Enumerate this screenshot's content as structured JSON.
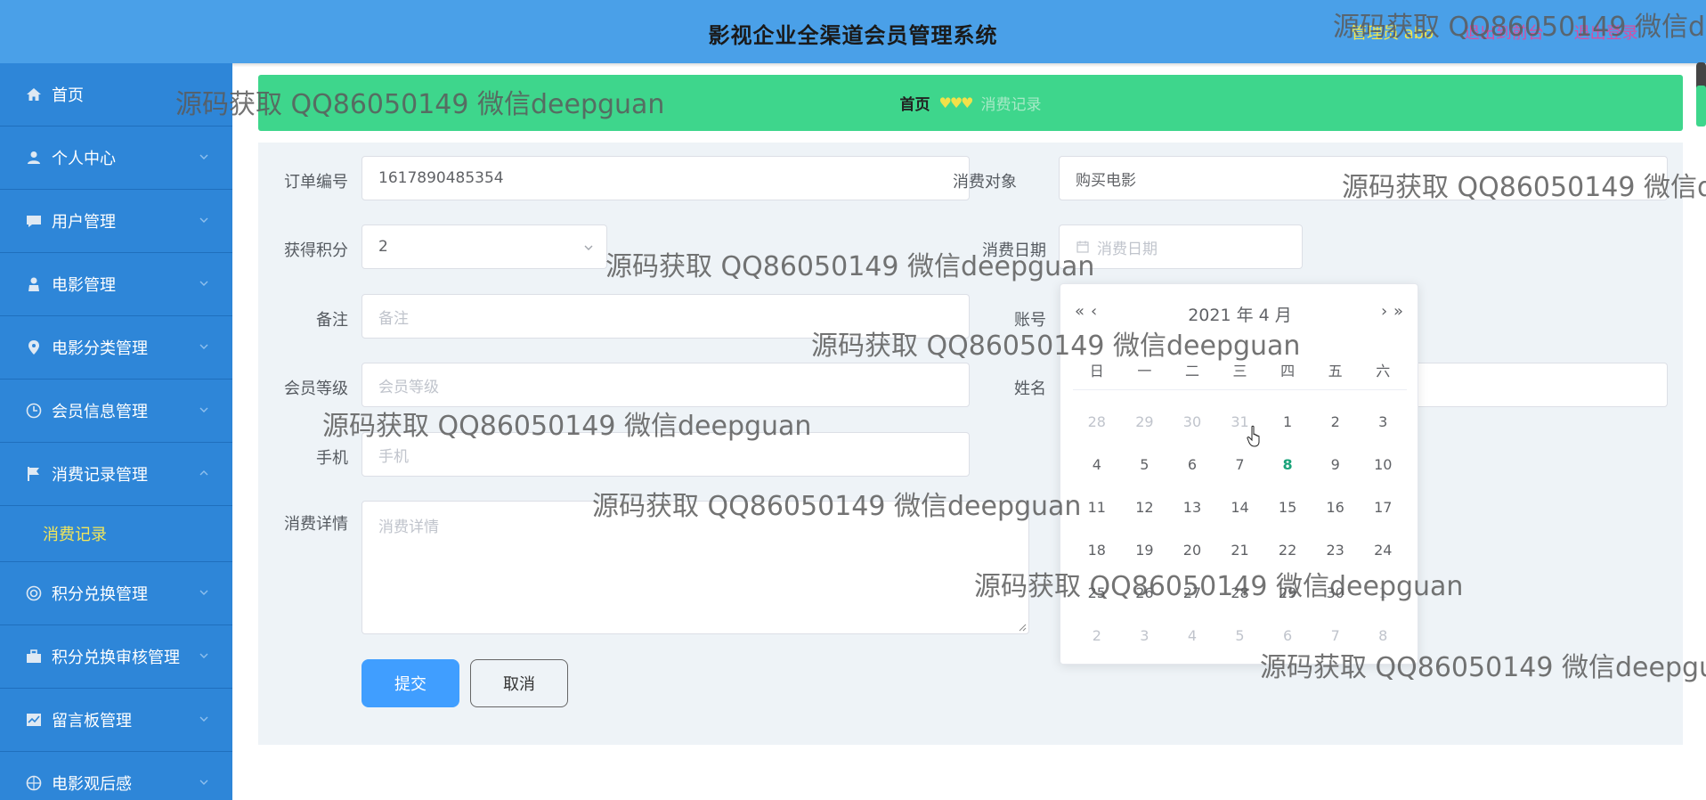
{
  "header": {
    "title": "影视企业全渠道会员管理系统",
    "admin_label": "管理员 abo",
    "front_link": "退出到前台",
    "logout_link": "退出登录"
  },
  "sidebar": {
    "items": [
      {
        "label": "首页",
        "icon": "home-icon"
      },
      {
        "label": "个人中心",
        "icon": "user-icon"
      },
      {
        "label": "用户管理",
        "icon": "chat-icon"
      },
      {
        "label": "电影管理",
        "icon": "person-icon"
      },
      {
        "label": "电影分类管理",
        "icon": "location-icon"
      },
      {
        "label": "会员信息管理",
        "icon": "clock-icon"
      },
      {
        "label": "消费记录管理",
        "icon": "flag-icon"
      },
      {
        "label": "积分兑换管理",
        "icon": "circle-icon"
      },
      {
        "label": "积分兑换审核管理",
        "icon": "briefcase-icon"
      },
      {
        "label": "留言板管理",
        "icon": "chart-icon"
      },
      {
        "label": "电影观后感",
        "icon": "compass-icon"
      }
    ],
    "submenu_label": "消费记录"
  },
  "breadcrumb": {
    "home": "首页",
    "separator": "♥♥♥",
    "current": "消费记录"
  },
  "form": {
    "order_no_label": "订单编号",
    "order_no_value": "1617890485354",
    "target_label": "消费对象",
    "target_value": "购买电影",
    "points_label": "获得积分",
    "points_value": "2",
    "date_label": "消费日期",
    "date_placeholder": "消费日期",
    "remark_label": "备注",
    "remark_placeholder": "备注",
    "account_label": "账号",
    "level_label": "会员等级",
    "level_placeholder": "会员等级",
    "name_label": "姓名",
    "phone_label": "手机",
    "phone_placeholder": "手机",
    "detail_label": "消费详情",
    "detail_placeholder": "消费详情",
    "submit_label": "提交",
    "cancel_label": "取消"
  },
  "datepicker": {
    "title": "2021 年  4 月",
    "prev_year": "«",
    "prev_month": "‹",
    "next_month": "›",
    "next_year": "»",
    "weekdays": [
      "日",
      "一",
      "二",
      "三",
      "四",
      "五",
      "六"
    ],
    "today": "8",
    "rows": [
      [
        {
          "d": "28",
          "o": true
        },
        {
          "d": "29",
          "o": true
        },
        {
          "d": "30",
          "o": true
        },
        {
          "d": "31",
          "o": true
        },
        {
          "d": "1"
        },
        {
          "d": "2"
        },
        {
          "d": "3"
        }
      ],
      [
        {
          "d": "4"
        },
        {
          "d": "5"
        },
        {
          "d": "6"
        },
        {
          "d": "7"
        },
        {
          "d": "8",
          "t": true
        },
        {
          "d": "9"
        },
        {
          "d": "10"
        }
      ],
      [
        {
          "d": "11"
        },
        {
          "d": "12"
        },
        {
          "d": "13"
        },
        {
          "d": "14"
        },
        {
          "d": "15"
        },
        {
          "d": "16"
        },
        {
          "d": "17"
        }
      ],
      [
        {
          "d": "18"
        },
        {
          "d": "19"
        },
        {
          "d": "20"
        },
        {
          "d": "21"
        },
        {
          "d": "22"
        },
        {
          "d": "23"
        },
        {
          "d": "24"
        }
      ],
      [
        {
          "d": "25"
        },
        {
          "d": "26"
        },
        {
          "d": "27"
        },
        {
          "d": "28"
        },
        {
          "d": "29"
        },
        {
          "d": "30"
        },
        {
          "d": "1",
          "o": true
        }
      ],
      [
        {
          "d": "2",
          "o": true
        },
        {
          "d": "3",
          "o": true
        },
        {
          "d": "4",
          "o": true
        },
        {
          "d": "5",
          "o": true
        },
        {
          "d": "6",
          "o": true
        },
        {
          "d": "7",
          "o": true
        },
        {
          "d": "8",
          "o": true
        }
      ]
    ]
  },
  "watermark": "源码获取 QQ86050149 微信deepguan"
}
